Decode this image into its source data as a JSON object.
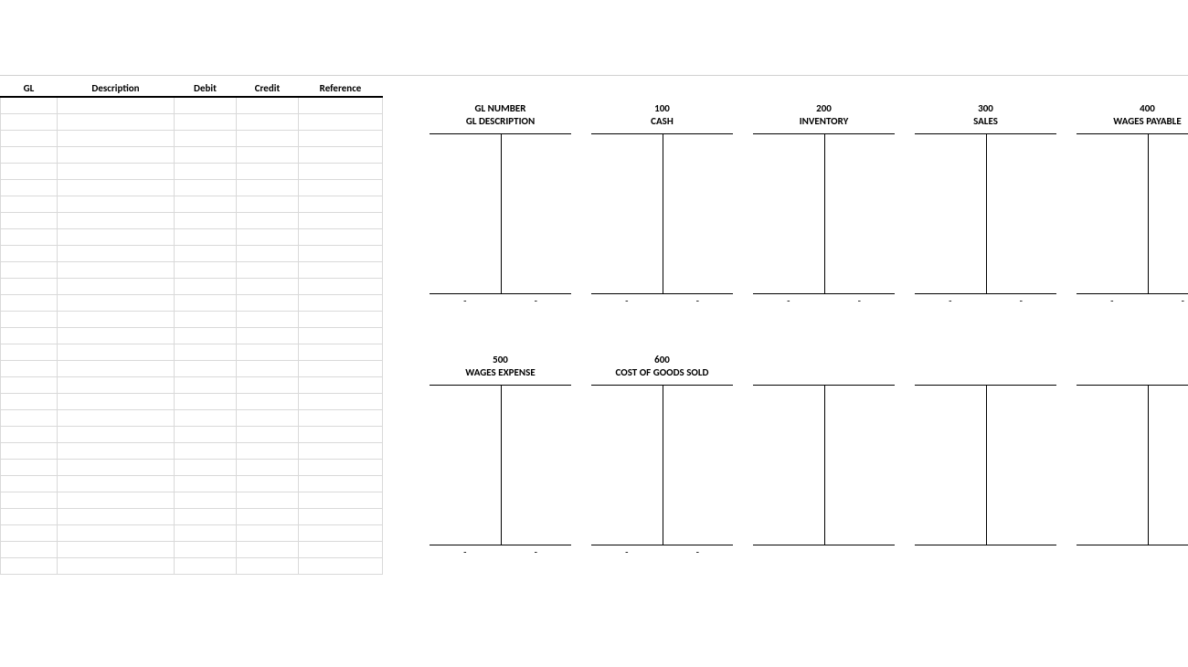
{
  "journal": {
    "headers": {
      "gl": "GL",
      "desc": "Description",
      "debit": "Debit",
      "credit": "Credit",
      "ref": "Reference"
    },
    "row_count": 29
  },
  "t_accounts": {
    "row1": [
      {
        "num": "GL NUMBER",
        "desc": "GL DESCRIPTION",
        "left": "-",
        "right": "-"
      },
      {
        "num": "100",
        "desc": "CASH",
        "left": "-",
        "right": "-"
      },
      {
        "num": "200",
        "desc": "INVENTORY",
        "left": "-",
        "right": "-"
      },
      {
        "num": "300",
        "desc": "SALES",
        "left": "-",
        "right": "-"
      },
      {
        "num": "400",
        "desc": "WAGES PAYABLE",
        "left": "-",
        "right": "-"
      }
    ],
    "row2": [
      {
        "num": "500",
        "desc": "WAGES EXPENSE",
        "left": "-",
        "right": "-"
      },
      {
        "num": "600",
        "desc": "COST OF GOODS SOLD",
        "left": "-",
        "right": "-"
      },
      {
        "num": "",
        "desc": "",
        "left": "",
        "right": ""
      },
      {
        "num": "",
        "desc": "",
        "left": "",
        "right": ""
      },
      {
        "num": "",
        "desc": "",
        "left": "",
        "right": ""
      }
    ]
  }
}
